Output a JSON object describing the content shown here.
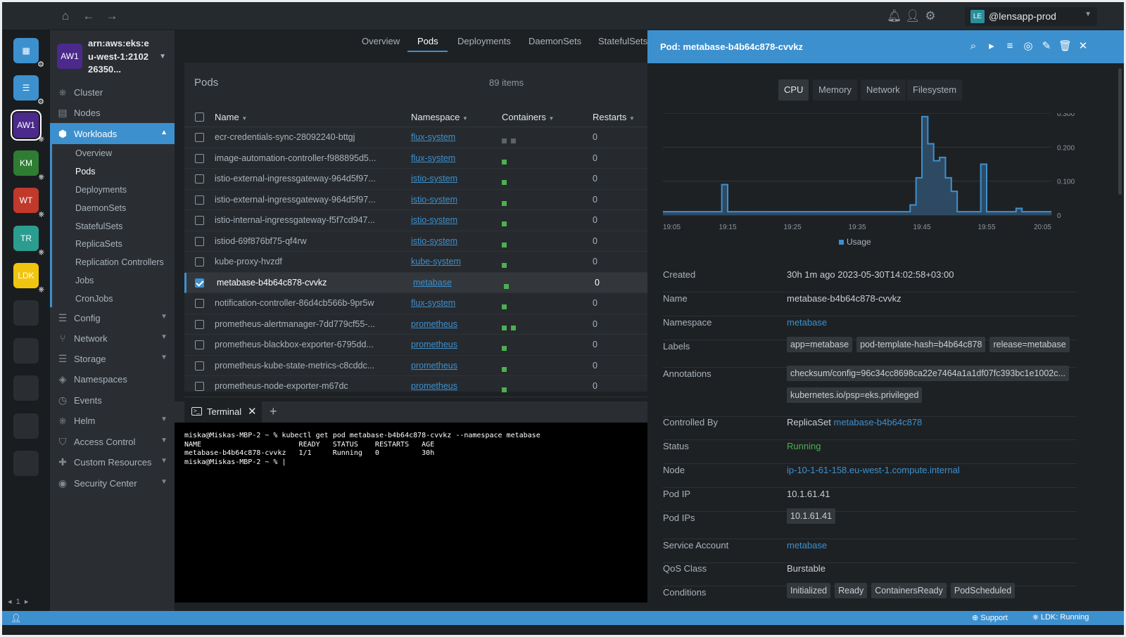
{
  "topbar": {
    "icons": [
      "home-icon",
      "back-icon",
      "forward-icon",
      "bell-icon",
      "add-user-icon",
      "gear-icon"
    ],
    "context": {
      "badge": "LE",
      "name": "@lensapp-prod"
    }
  },
  "hotbar": {
    "items": [
      {
        "label": "",
        "color": "#3d90ce",
        "icon": "catalog-icon"
      },
      {
        "label": "",
        "color": "#3d90ce",
        "icon": "list-icon"
      },
      {
        "label": "AW1",
        "color": "#4b2a8c"
      },
      {
        "label": "KM",
        "color": "#2e7d32"
      },
      {
        "label": "WT",
        "color": "#c0392b"
      },
      {
        "label": "TR",
        "color": "#2a9d8f"
      },
      {
        "label": "LDK",
        "color": "#f1c40f"
      }
    ],
    "page": "1"
  },
  "cluster": {
    "badge": "AW1",
    "name": "arn:aws:eks:eu-west-1:210226350..."
  },
  "sidebar": {
    "items": [
      {
        "label": "Cluster",
        "icon": "cluster-icon"
      },
      {
        "label": "Nodes",
        "icon": "nodes-icon"
      },
      {
        "label": "Workloads",
        "icon": "workloads-icon"
      },
      {
        "label": "Config",
        "icon": "config-icon"
      },
      {
        "label": "Network",
        "icon": "network-icon"
      },
      {
        "label": "Storage",
        "icon": "storage-icon"
      },
      {
        "label": "Namespaces",
        "icon": "namespaces-icon"
      },
      {
        "label": "Events",
        "icon": "events-icon"
      },
      {
        "label": "Helm",
        "icon": "helm-icon"
      },
      {
        "label": "Access Control",
        "icon": "shield-icon"
      },
      {
        "label": "Custom Resources",
        "icon": "puzzle-icon"
      },
      {
        "label": "Security Center",
        "icon": "security-icon"
      }
    ],
    "workloads_sub": [
      "Overview",
      "Pods",
      "Deployments",
      "DaemonSets",
      "StatefulSets",
      "ReplicaSets",
      "Replication Controllers",
      "Jobs",
      "CronJobs"
    ]
  },
  "tabs": [
    "Overview",
    "Pods",
    "Deployments",
    "DaemonSets",
    "StatefulSets"
  ],
  "pods": {
    "title": "Pods",
    "count": "89 items",
    "columns": [
      "Name",
      "Namespace",
      "Containers",
      "Restarts"
    ],
    "rows": [
      {
        "name": "ecr-credentials-sync-28092240-bttgj",
        "ns": "flux-system",
        "containers": [
          "grey",
          "grey"
        ],
        "restarts": "0"
      },
      {
        "name": "image-automation-controller-f988895d5...",
        "ns": "flux-system",
        "containers": [
          "green"
        ],
        "restarts": "0"
      },
      {
        "name": "istio-external-ingressgateway-964d5f97...",
        "ns": "istio-system",
        "containers": [
          "green"
        ],
        "restarts": "0"
      },
      {
        "name": "istio-external-ingressgateway-964d5f97...",
        "ns": "istio-system",
        "containers": [
          "green"
        ],
        "restarts": "0"
      },
      {
        "name": "istio-internal-ingressgateway-f5f7cd947...",
        "ns": "istio-system",
        "containers": [
          "green"
        ],
        "restarts": "0"
      },
      {
        "name": "istiod-69f876bf75-qf4rw",
        "ns": "istio-system",
        "containers": [
          "green"
        ],
        "restarts": "0"
      },
      {
        "name": "kube-proxy-hvzdf",
        "ns": "kube-system",
        "containers": [
          "green"
        ],
        "restarts": "0"
      },
      {
        "name": "metabase-b4b64c878-cvvkz",
        "ns": "metabase",
        "containers": [
          "green"
        ],
        "restarts": "0",
        "selected": true
      },
      {
        "name": "notification-controller-86d4cb566b-9pr5w",
        "ns": "flux-system",
        "containers": [
          "green"
        ],
        "restarts": "0"
      },
      {
        "name": "prometheus-alertmanager-7dd779cf55-...",
        "ns": "prometheus",
        "containers": [
          "green",
          "green"
        ],
        "restarts": "0"
      },
      {
        "name": "prometheus-blackbox-exporter-6795dd...",
        "ns": "prometheus",
        "containers": [
          "green"
        ],
        "restarts": "0"
      },
      {
        "name": "prometheus-kube-state-metrics-c8cddc...",
        "ns": "prometheus",
        "containers": [
          "green"
        ],
        "restarts": "0"
      },
      {
        "name": "prometheus-node-exporter-m67dc",
        "ns": "prometheus",
        "containers": [
          "green"
        ],
        "restarts": "0"
      }
    ]
  },
  "terminal": {
    "tab": "Terminal",
    "lines": [
      "miska@Miskas-MBP-2 ~ % kubectl get pod metabase-b4b64c878-cvvkz --namespace metabase",
      "NAME                       READY   STATUS    RESTARTS   AGE",
      "metabase-b4b64c878-cvvkz   1/1     Running   0          30h",
      "miska@Miskas-MBP-2 ~ % |"
    ]
  },
  "drawer": {
    "title": "Pod: metabase-b4b64c878-cvvkz",
    "actions": [
      "search-icon",
      "terminal-icon",
      "logs-icon",
      "attach-icon",
      "edit-icon",
      "delete-icon",
      "close-icon"
    ],
    "metric_tabs": [
      "CPU",
      "Memory",
      "Network",
      "Filesystem"
    ],
    "details": {
      "created": {
        "label": "Created",
        "value": "30h 1m ago 2023-05-30T14:02:58+03:00"
      },
      "name": {
        "label": "Name",
        "value": "metabase-b4b64c878-cvvkz"
      },
      "namespace": {
        "label": "Namespace",
        "value": "metabase"
      },
      "labels": {
        "label": "Labels",
        "chips": [
          "app=metabase",
          "pod-template-hash=b4b64c878",
          "release=metabase"
        ]
      },
      "annotations": {
        "label": "Annotations",
        "chips": [
          "checksum/config=96c34cc8698ca22e7464a1a1df07fc393bc1e1002c...",
          "kubernetes.io/psp=eks.privileged"
        ]
      },
      "controlled_by": {
        "label": "Controlled By",
        "prefix": "ReplicaSet",
        "value": "metabase-b4b64c878"
      },
      "status": {
        "label": "Status",
        "value": "Running"
      },
      "node": {
        "label": "Node",
        "value": "ip-10-1-61-158.eu-west-1.compute.internal"
      },
      "pod_ip": {
        "label": "Pod IP",
        "value": "10.1.61.41"
      },
      "pod_ips": {
        "label": "Pod IPs",
        "chips": [
          "10.1.61.41"
        ]
      },
      "service_account": {
        "label": "Service Account",
        "value": "metabase"
      },
      "qos": {
        "label": "QoS Class",
        "value": "Burstable"
      },
      "conditions": {
        "label": "Conditions",
        "chips": [
          "Initialized",
          "Ready",
          "ContainersReady",
          "PodScheduled"
        ]
      }
    }
  },
  "chart_data": {
    "type": "bar",
    "title": "",
    "xlabel": "",
    "ylabel": "",
    "x_ticks": [
      "19:05",
      "19:15",
      "19:25",
      "19:35",
      "19:45",
      "19:55",
      "20:05"
    ],
    "y_ticks": [
      "0",
      "0.100",
      "0.200",
      "0.300"
    ],
    "ylim": [
      0,
      0.3
    ],
    "legend": "bottom",
    "series": [
      {
        "name": "Usage",
        "color": "#3d90ce",
        "values": [
          0.01,
          0.01,
          0.01,
          0.01,
          0.01,
          0.01,
          0.01,
          0.01,
          0.01,
          0.01,
          0.09,
          0.01,
          0.01,
          0.01,
          0.01,
          0.01,
          0.01,
          0.01,
          0.01,
          0.01,
          0.01,
          0.01,
          0.01,
          0.01,
          0.01,
          0.01,
          0.01,
          0.01,
          0.01,
          0.01,
          0.01,
          0.01,
          0.01,
          0.01,
          0.01,
          0.01,
          0.01,
          0.01,
          0.01,
          0.01,
          0.01,
          0.01,
          0.03,
          0.11,
          0.29,
          0.21,
          0.16,
          0.17,
          0.11,
          0.07,
          0.01,
          0.01,
          0.01,
          0.01,
          0.15,
          0.01,
          0.01,
          0.01,
          0.01,
          0.01,
          0.02,
          0.01,
          0.01,
          0.01,
          0.01,
          0.01
        ]
      }
    ]
  },
  "statusbar": {
    "support": "Support",
    "ldk": "LDK: Running"
  }
}
